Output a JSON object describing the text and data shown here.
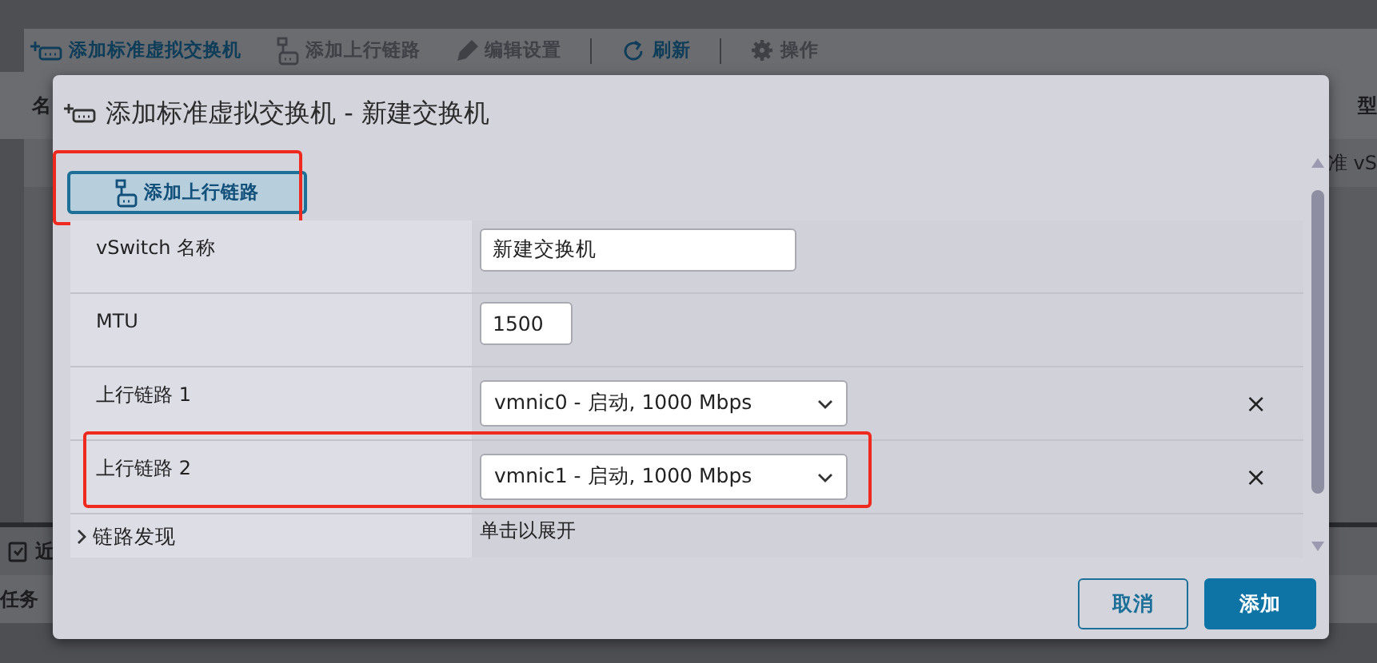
{
  "toolbar": [
    {
      "label": "添加标准虚拟交换机",
      "disabled": false,
      "separator_before": false
    },
    {
      "label": "添加上行链路",
      "disabled": true,
      "separator_before": false
    },
    {
      "label": "编辑设置",
      "disabled": true,
      "separator_before": false
    },
    {
      "label": "刷新",
      "disabled": false,
      "separator_before": true
    },
    {
      "label": "操作",
      "disabled": true,
      "separator_before": true
    }
  ],
  "background": {
    "header_left": "名",
    "header_right": "型",
    "row_right": "准 vS",
    "panel_title": "近",
    "tasks_header": "任务"
  },
  "dialog": {
    "title": "添加标准虚拟交换机 - 新建交换机",
    "add_uplink_button": {
      "label": "添加上行链路",
      "highlighted": true
    },
    "rows": [
      {
        "kind": "text",
        "label": "vSwitch 名称",
        "value": "新建交换机",
        "highlighted": false
      },
      {
        "kind": "text",
        "label": "MTU",
        "value": "1500",
        "highlighted": false
      },
      {
        "kind": "select",
        "label": "上行链路 1",
        "value": "vmnic0 - 启动, 1000 Mbps",
        "remove": "×",
        "highlighted": false
      },
      {
        "kind": "select",
        "label": "上行链路 2",
        "value": "vmnic1 - 启动, 1000 Mbps",
        "remove": "×",
        "highlighted": true
      },
      {
        "kind": "expander",
        "label": "链路发现",
        "value": "单击以展开",
        "expanded": false,
        "highlighted": false
      }
    ],
    "buttons": [
      {
        "label": "取消",
        "primary": false
      },
      {
        "label": "添加",
        "primary": true
      }
    ]
  }
}
